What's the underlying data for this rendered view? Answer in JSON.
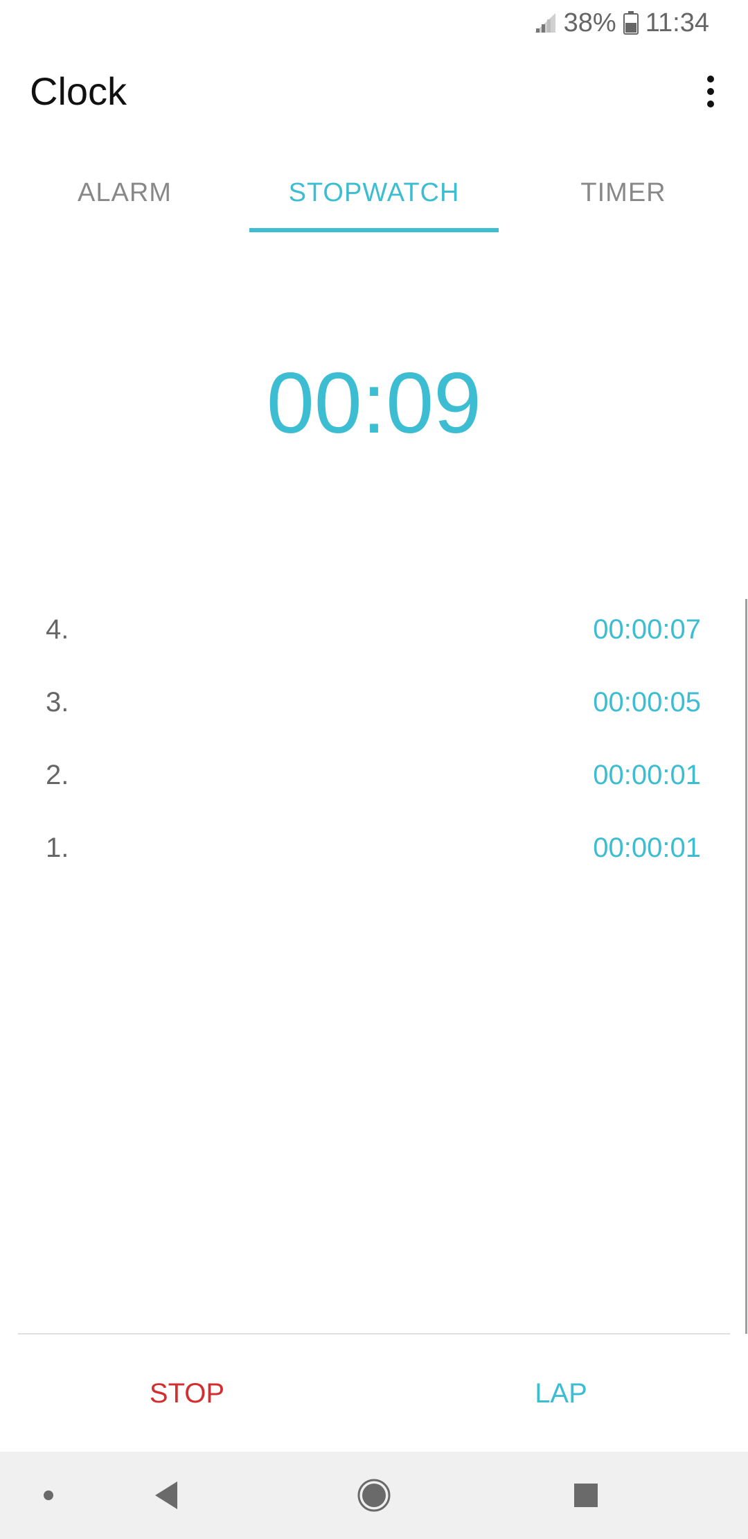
{
  "status_bar": {
    "battery_percent": "38%",
    "time": "11:34",
    "icons": [
      "signal-icon",
      "battery-icon"
    ]
  },
  "app_bar": {
    "title": "Clock",
    "menu_icon": "more-vert-icon"
  },
  "tabs": [
    {
      "label": "ALARM",
      "selected": false
    },
    {
      "label": "STOPWATCH",
      "selected": true
    },
    {
      "label": "TIMER",
      "selected": false
    }
  ],
  "stopwatch": {
    "elapsed": "00:09"
  },
  "laps": [
    {
      "index": "4.",
      "time": "00:00:07"
    },
    {
      "index": "3.",
      "time": "00:00:05"
    },
    {
      "index": "2.",
      "time": "00:00:01"
    },
    {
      "index": "1.",
      "time": "00:00:01"
    }
  ],
  "buttons": {
    "stop_label": "STOP",
    "lap_label": "LAP"
  },
  "nav_bar": {
    "icons": [
      "dot-icon",
      "back-icon",
      "home-icon",
      "recents-icon"
    ]
  },
  "colors": {
    "accent": "#3dbdd1",
    "stop": "#d32f2f",
    "text_secondary": "#666666",
    "nav_background": "#f0f0f0"
  }
}
